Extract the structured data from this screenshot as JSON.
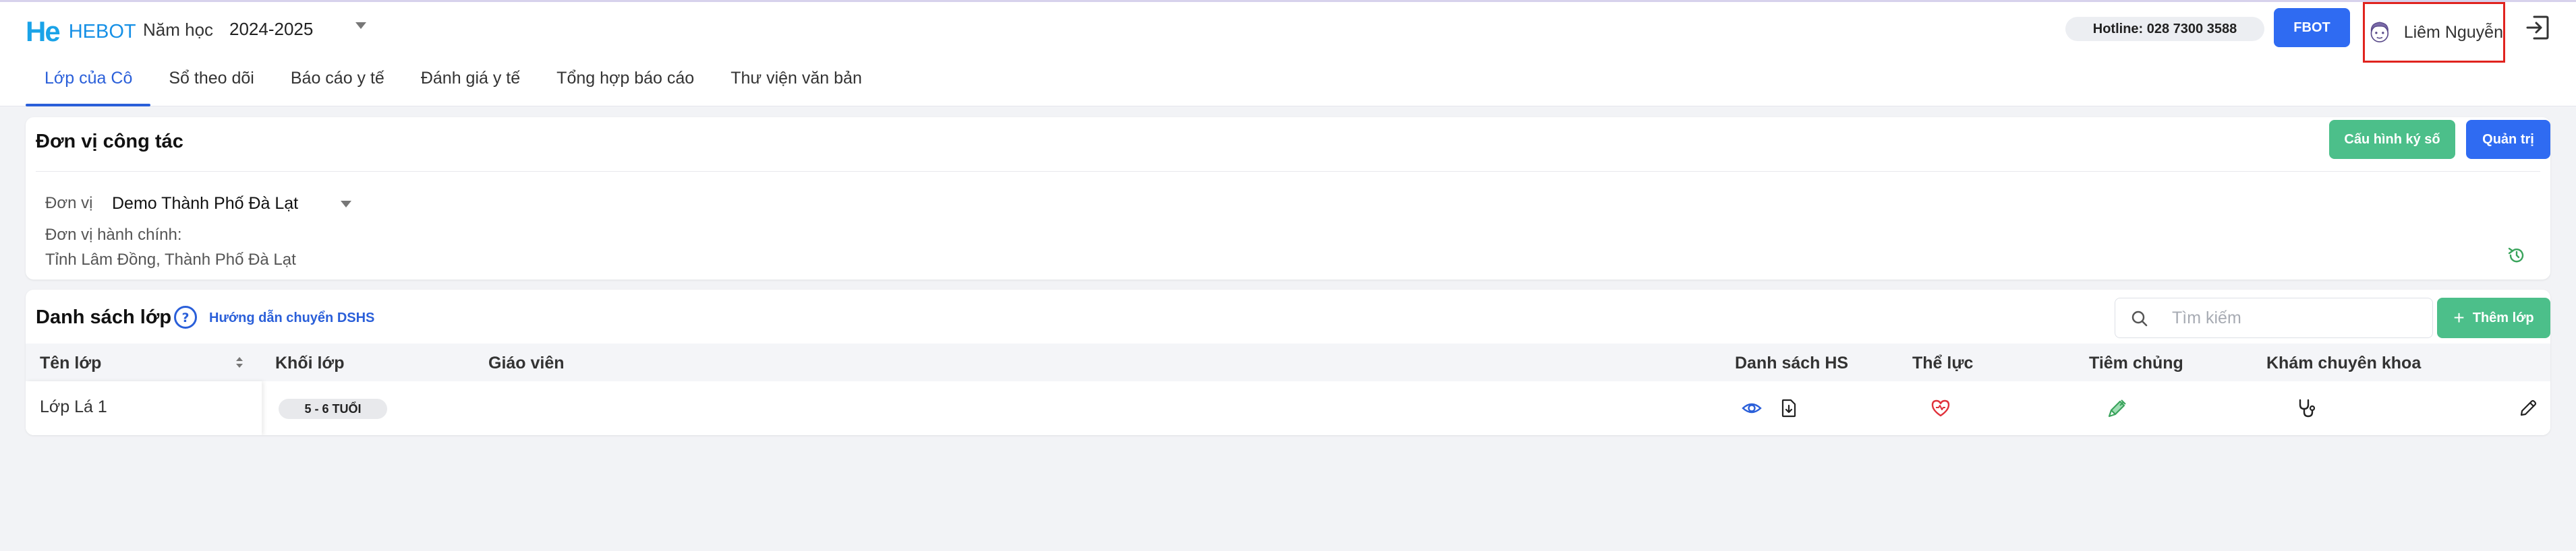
{
  "header": {
    "logo_mark": "He",
    "app_name": "HEBOT",
    "year_label": "Năm học",
    "year_value": "2024-2025",
    "hotline": "Hotline: 028 7300 3588",
    "fbot_label": "FBOT",
    "user_name": "Liêm Nguyễn"
  },
  "tabs": [
    {
      "label": "Lớp của Cô",
      "active": true
    },
    {
      "label": "Sổ theo dõi",
      "active": false
    },
    {
      "label": "Báo cáo y tế",
      "active": false
    },
    {
      "label": "Đánh giá y tế",
      "active": false
    },
    {
      "label": "Tổng hợp báo cáo",
      "active": false
    },
    {
      "label": "Thư viện văn bản",
      "active": false
    }
  ],
  "unit_card": {
    "title": "Đơn vị công tác",
    "config_button": "Cấu hình ký số",
    "admin_button": "Quản trị",
    "unit_label": "Đơn vị",
    "unit_value": "Demo Thành Phố Đà Lạt",
    "admin_unit_label": "Đơn vị hành chính:",
    "admin_unit_value": "Tỉnh Lâm Đồng, Thành Phố Đà Lạt"
  },
  "class_list": {
    "title": "Danh sách lớp",
    "help_link": "Hướng dẫn chuyển DSHS",
    "search_placeholder": "Tìm kiếm",
    "add_button": "Thêm lớp",
    "columns": {
      "class_name": "Tên lớp",
      "grade": "Khối lớp",
      "teacher": "Giáo viên",
      "students": "Danh sách HS",
      "fitness": "Thể lực",
      "vaccination": "Tiêm chủng",
      "specialist": "Khám chuyên khoa"
    },
    "rows": [
      {
        "class_name": "Lớp Lá 1",
        "grade": "5 - 6 TUỔI",
        "teacher": ""
      }
    ]
  },
  "colors": {
    "primary": "#2f6bf2",
    "green": "#4cbf8a",
    "active_tab": "#2a5fd9",
    "highlight_border": "#e0231e"
  }
}
